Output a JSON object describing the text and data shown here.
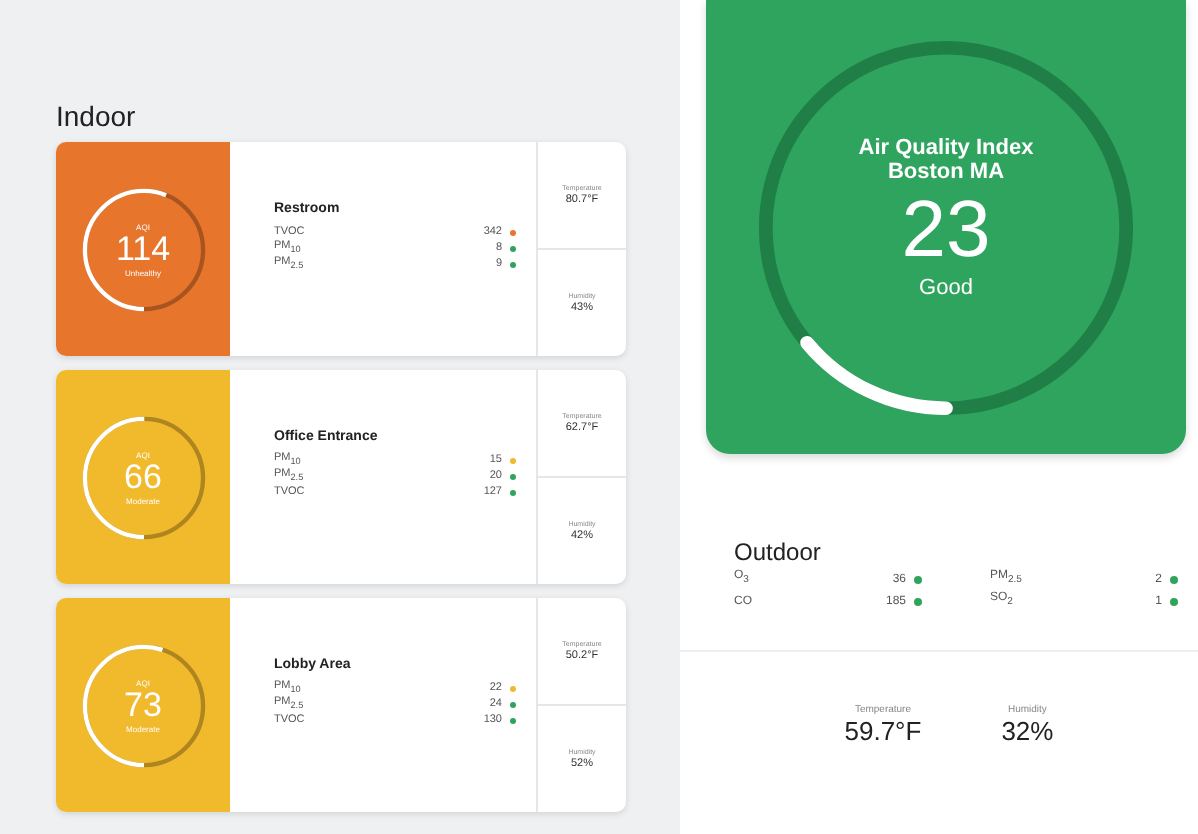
{
  "indoor": {
    "title": "Indoor",
    "rooms": [
      {
        "label": "AQI",
        "aqi": "114",
        "status": "Unhealthy",
        "color": "#e8752c",
        "level": 0.56,
        "name": "Restroom",
        "metrics": [
          {
            "name": "TVOC",
            "value": "342",
            "color": "#e8752c"
          },
          {
            "name": "PM$_{10}$",
            "value": "8",
            "color": "#2fa45f"
          },
          {
            "name": "PM$_{2.5}$",
            "value": "9",
            "color": "#2fa45f"
          }
        ],
        "temperature_label": "Temperature",
        "temperature": "80.7°F",
        "humidity_label": "Humidity",
        "humidity": "43%"
      },
      {
        "label": "AQI",
        "aqi": "66",
        "status": "Moderate",
        "color": "#f1b92c",
        "level": 0.5,
        "name": "Office Entrance",
        "metrics": [
          {
            "name": "PM$_{10}$",
            "value": "15",
            "color": "#f1b92c"
          },
          {
            "name": "PM$_{2.5}$",
            "value": "20",
            "color": "#2fa45f"
          },
          {
            "name": "TVOC",
            "value": "127",
            "color": "#2fa45f"
          }
        ],
        "temperature_label": "Temperature",
        "temperature": "62.7°F",
        "humidity_label": "Humidity",
        "humidity": "42%"
      },
      {
        "label": "AQI",
        "aqi": "73",
        "status": "Moderate",
        "color": "#f1b92c",
        "level": 0.55,
        "name": "Lobby Area",
        "metrics": [
          {
            "name": "PM$_{10}$",
            "value": "22",
            "color": "#f1b92c"
          },
          {
            "name": "PM$_{2.5}$",
            "value": "24",
            "color": "#2fa45f"
          },
          {
            "name": "TVOC",
            "value": "130",
            "color": "#2fa45f"
          }
        ],
        "temperature_label": "Temperature",
        "temperature": "50.2°F",
        "humidity_label": "Humidity",
        "humidity": "52%"
      }
    ]
  },
  "aqi_card": {
    "title": "Air Quality Index",
    "location": "Boston MA",
    "aqi": "23",
    "status": "Good",
    "level": 0.14
  },
  "outdoor": {
    "title": "Outdoor",
    "metrics": [
      {
        "name": "O$_{3}$",
        "value": "36",
        "color": "#2fa45f"
      },
      {
        "name": "PM$_{2.5}$",
        "value": "2",
        "color": "#2fa45f"
      },
      {
        "name": "CO",
        "value": "185",
        "color": "#2fa45f"
      },
      {
        "name": "SO$_{2}$",
        "value": "1",
        "color": "#2fa45f"
      }
    ],
    "temperature_label": "Temperature",
    "temperature": "59.7°F",
    "humidity_label": "Humidity",
    "humidity": "32%"
  }
}
